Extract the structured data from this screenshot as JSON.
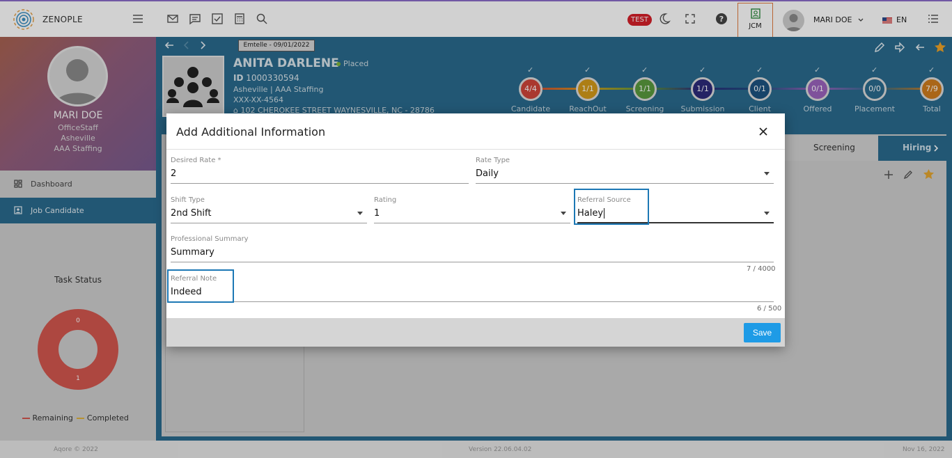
{
  "topbar": {
    "brand": "ZENOPLE",
    "test_badge": "TEST",
    "jcm_label": "JCM",
    "user_name": "MARI DOE",
    "language": "EN"
  },
  "sidebar": {
    "profile_name": "MARI DOE",
    "profile_role": "OfficeStaff",
    "profile_location": "Asheville",
    "profile_company": "AAA Staffing",
    "nav": [
      {
        "label": "Dashboard",
        "icon": "dashboard-icon"
      },
      {
        "label": "Job Candidate",
        "icon": "job-candidate-icon"
      }
    ],
    "task_status_title": "Task Status",
    "donut_values": {
      "top": "0",
      "bottom": "1"
    },
    "legend": {
      "remaining": "Remaining",
      "completed": "Completed"
    },
    "colors": {
      "remaining": "#d4574f",
      "completed": "#e0b13b"
    }
  },
  "candidate": {
    "chip": "Emtelle - 09/01/2022",
    "name": "ANITA DARLENE",
    "status": "Placed",
    "id_label": "ID",
    "id": "1000330594",
    "location": "Asheville | AAA Staffing",
    "ssn": "XXX-XX-4564",
    "address": "102 CHEROKEE STREET WAYNESVILLE, NC - 28786"
  },
  "pipeline": [
    {
      "label": "Candidate",
      "value": "4/4",
      "color": "#d0453a"
    },
    {
      "label": "ReachOut",
      "value": "1/1",
      "color": "#d39a1a"
    },
    {
      "label": "Screening",
      "value": "1/1",
      "color": "#5a9a3e"
    },
    {
      "label": "Submission",
      "value": "1/1",
      "color": "#2d2a7a"
    },
    {
      "label": "Client Intervi...",
      "value": "0/1",
      "color": "#1d5280"
    },
    {
      "label": "Offered",
      "value": "0/1",
      "color": "#9b63bd"
    },
    {
      "label": "Placement",
      "value": "0/0",
      "color": "#2a6b8e"
    },
    {
      "label": "Total",
      "value": "7/9",
      "color": "#d07d1e"
    }
  ],
  "tabs": [
    "Screening",
    "Hiring"
  ],
  "modal": {
    "title": "Add Additional Information",
    "desired_rate_label": "Desired Rate *",
    "desired_rate_value": "2",
    "rate_type_label": "Rate Type",
    "rate_type_value": "Daily",
    "shift_type_label": "Shift Type",
    "shift_type_value": "2nd Shift",
    "rating_label": "Rating",
    "rating_value": "1",
    "referral_source_label": "Referral Source",
    "referral_source_value": "Haley",
    "professional_summary_label": "Professional Summary",
    "professional_summary_value": "Summary",
    "summary_counter": "7 / 4000",
    "referral_note_label": "Referral Note",
    "referral_note_value": "Indeed",
    "note_counter": "6 / 500",
    "save_label": "Save"
  },
  "footer": {
    "copyright": "Aqore © 2022",
    "version": "Version 22.06.04.02",
    "date": "Nov 16, 2022"
  }
}
